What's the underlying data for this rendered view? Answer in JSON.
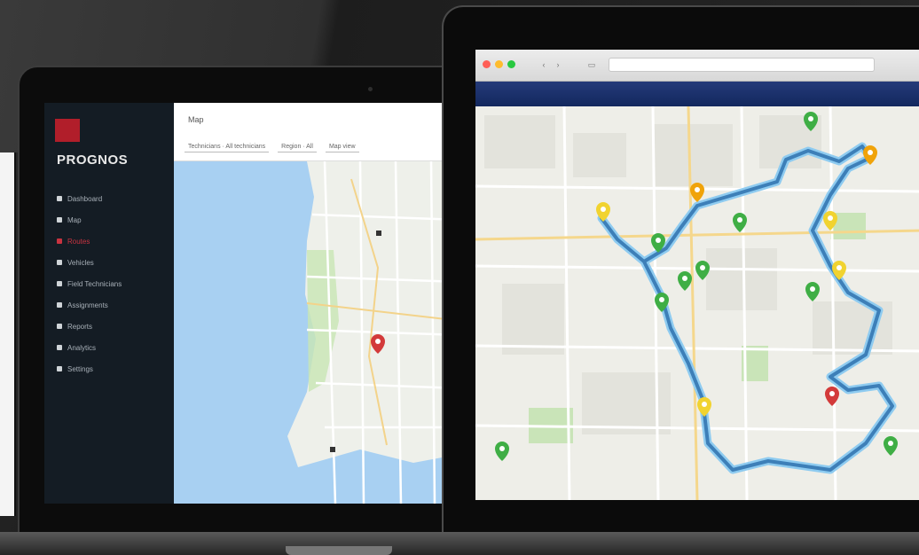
{
  "left_laptop": {
    "brand": "PROGNOS",
    "nav_items": [
      {
        "label": "Dashboard",
        "active": false
      },
      {
        "label": "Map",
        "active": false
      },
      {
        "label": "Routes",
        "active": true
      },
      {
        "label": "Vehicles",
        "active": false
      },
      {
        "label": "Field Technicians",
        "active": false
      },
      {
        "label": "Assignments",
        "active": false
      },
      {
        "label": "Reports",
        "active": false
      },
      {
        "label": "Analytics",
        "active": false
      },
      {
        "label": "Settings",
        "active": false
      }
    ],
    "breadcrumb": "Map",
    "filters": [
      "Technicians · All technicians",
      "Region · All",
      "Map view"
    ]
  },
  "right_laptop": {
    "window_buttons": {
      "close": "#ff5f57",
      "minimize": "#febc2e",
      "maximize": "#28c840"
    }
  },
  "colors": {
    "route": "#3d7fb8",
    "route_halo": "#8ecbf0",
    "marker_green": "#3fae45",
    "marker_orange": "#f0a30a",
    "marker_yellow": "#f1d330",
    "marker_red": "#d33a3a",
    "water": "#a8d0f2",
    "accent_red": "#b11e2a"
  },
  "map_markers": [
    {
      "type": "green",
      "icon": "map-pin-icon"
    },
    {
      "type": "orange",
      "icon": "map-pin-icon"
    },
    {
      "type": "yellow",
      "icon": "map-pin-icon"
    },
    {
      "type": "red",
      "icon": "map-pin-icon"
    }
  ]
}
